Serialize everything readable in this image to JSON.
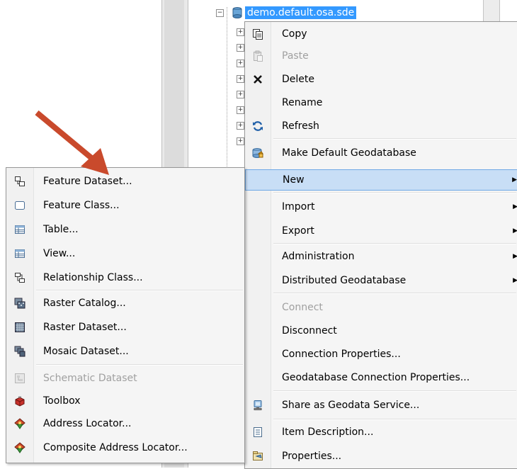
{
  "tree": {
    "root_label": "demo.default.osa.sde"
  },
  "context_menu": {
    "items": [
      {
        "label": "Copy",
        "icon": "copy-icon",
        "disabled": false
      },
      {
        "label": "Paste",
        "icon": "paste-icon",
        "disabled": true
      },
      {
        "label": "Delete",
        "icon": "delete-icon",
        "disabled": false
      },
      {
        "label": "Rename",
        "icon": "",
        "disabled": false
      },
      {
        "label": "Refresh",
        "icon": "refresh-icon",
        "disabled": false
      },
      {
        "label": "Make Default Geodatabase",
        "icon": "default-geodatabase-icon",
        "disabled": false
      },
      {
        "label": "New",
        "icon": "",
        "disabled": false,
        "submenu": true,
        "highlighted": true
      },
      {
        "label": "Import",
        "icon": "",
        "disabled": false,
        "submenu": true
      },
      {
        "label": "Export",
        "icon": "",
        "disabled": false,
        "submenu": true
      },
      {
        "label": "Administration",
        "icon": "",
        "disabled": false,
        "submenu": true
      },
      {
        "label": "Distributed Geodatabase",
        "icon": "",
        "disabled": false,
        "submenu": true
      },
      {
        "label": "Connect",
        "icon": "",
        "disabled": true
      },
      {
        "label": "Disconnect",
        "icon": "",
        "disabled": false
      },
      {
        "label": "Connection Properties...",
        "icon": "",
        "disabled": false
      },
      {
        "label": "Geodatabase Connection Properties...",
        "icon": "",
        "disabled": false
      },
      {
        "label": "Share as Geodata Service...",
        "icon": "share-service-icon",
        "disabled": false
      },
      {
        "label": "Item Description...",
        "icon": "item-description-icon",
        "disabled": false
      },
      {
        "label": "Properties...",
        "icon": "properties-icon",
        "disabled": false
      }
    ]
  },
  "new_submenu": {
    "items": [
      {
        "label": "Feature Dataset...",
        "icon": "feature-dataset-icon",
        "disabled": false
      },
      {
        "label": "Feature Class...",
        "icon": "feature-class-icon",
        "disabled": false
      },
      {
        "label": "Table...",
        "icon": "table-icon",
        "disabled": false
      },
      {
        "label": "View...",
        "icon": "view-icon",
        "disabled": false
      },
      {
        "label": "Relationship Class...",
        "icon": "relationship-class-icon",
        "disabled": false
      },
      {
        "label": "Raster Catalog...",
        "icon": "raster-catalog-icon",
        "disabled": false
      },
      {
        "label": "Raster Dataset...",
        "icon": "raster-dataset-icon",
        "disabled": false
      },
      {
        "label": "Mosaic Dataset...",
        "icon": "mosaic-dataset-icon",
        "disabled": false
      },
      {
        "label": "Schematic Dataset",
        "icon": "schematic-dataset-icon",
        "disabled": true
      },
      {
        "label": "Toolbox",
        "icon": "toolbox-icon",
        "disabled": false
      },
      {
        "label": "Address Locator...",
        "icon": "address-locator-icon",
        "disabled": false
      },
      {
        "label": "Composite Address Locator...",
        "icon": "composite-address-locator-icon",
        "disabled": false
      }
    ]
  },
  "colors": {
    "selection": "#3399ff",
    "highlight_bg": "#c8def6",
    "highlight_border": "#6fa8e6",
    "annotation_arrow": "#c0392b"
  }
}
